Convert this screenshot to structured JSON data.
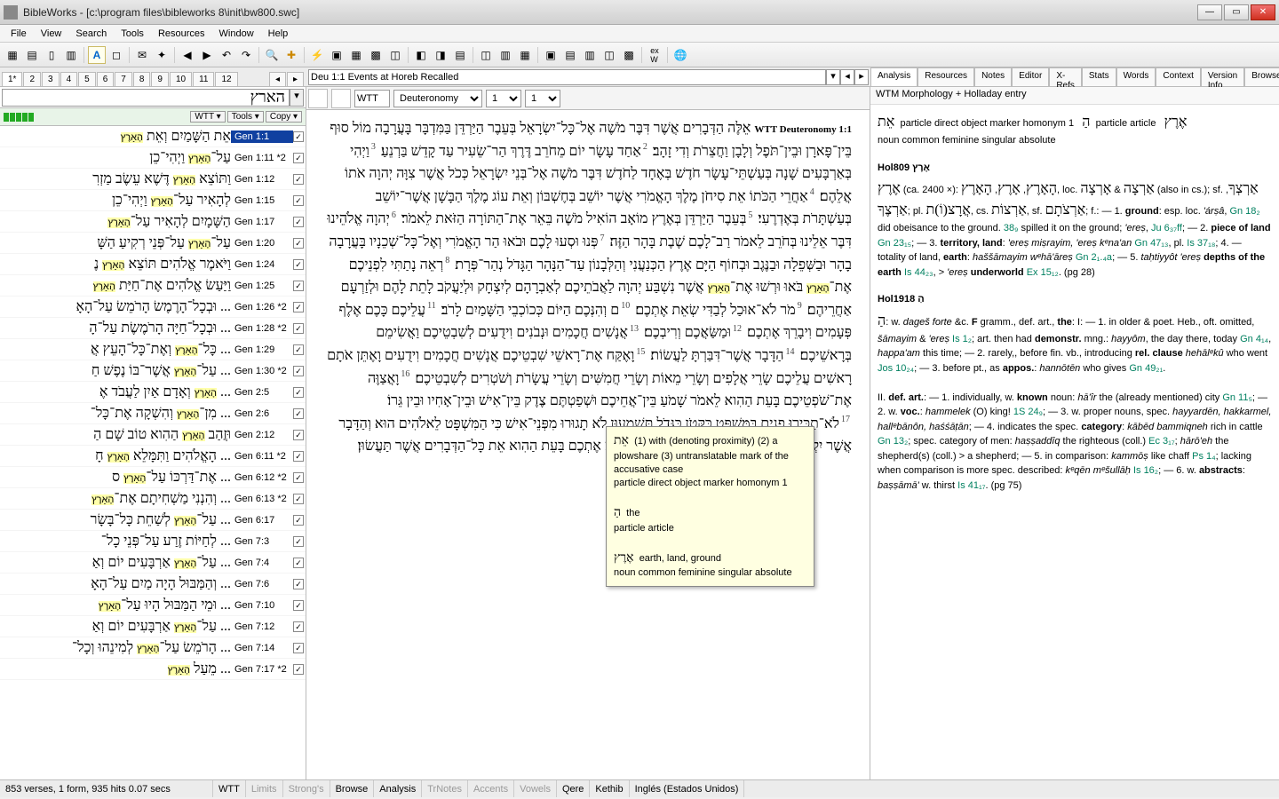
{
  "window": {
    "title": "BibleWorks - [c:\\program files\\bibleworks 8\\init\\bw800.swc]"
  },
  "menus": [
    "File",
    "View",
    "Search",
    "Tools",
    "Resources",
    "Window",
    "Help"
  ],
  "tabs": [
    "1*",
    "2",
    "3",
    "4",
    "5",
    "6",
    "7",
    "8",
    "9",
    "10",
    "11",
    "12"
  ],
  "location": "Deu 1:1 Events at Horeb Recalled",
  "search_term": "הארץ",
  "ctl": {
    "ver": "WTT ▾",
    "tools": "Tools ▾",
    "copy": "Copy ▾"
  },
  "results": [
    {
      "ref": "Gen 1:1",
      "sel": true,
      "heb": "אֵת הַשָּׁמַיִם וְאֵת הָאָרֶץ"
    },
    {
      "ref": "Gen 1:11 *2",
      "heb": "עַל־הָאָרֶץ וַיְהִי־כֵן"
    },
    {
      "ref": "Gen 1:12",
      "heb": "וַתּוֹצֵא הָאָרֶץ דֶּשֶׁא עֵשֶׂב מַזְרִ"
    },
    {
      "ref": "Gen 1:15",
      "heb": "לְהָאִיר עַל־הָאָרֶץ וַיְהִי־כֵן"
    },
    {
      "ref": "Gen 1:17",
      "heb": "הַשָּׁמָיִם לְהָאִיר עַל־הָאָרֶץ"
    },
    {
      "ref": "Gen 1:20",
      "heb": "עַל־הָאָרֶץ עַל־פְּנֵי רְקִיעַ הַשָּׁ"
    },
    {
      "ref": "Gen 1:24",
      "heb": "וַיֹּאמֶר אֱלֹהִים תּוֹצֵא הָאָרֶץ נֶ"
    },
    {
      "ref": "Gen 1:25",
      "heb": "וַיַּעַשׂ אֱלֹהִים אֶת־חַיַּת הָאָרֶץ"
    },
    {
      "ref": "Gen 1:26 *2",
      "heb": "... וּבְכָל־הָרֶמֶשׂ הָרֹמֵשׂ עַל־הָאָ"
    },
    {
      "ref": "Gen 1:28 *2",
      "heb": "... וּבְכָל־חַיָּה הָרֹמֶשֶׂת עַל־הָ"
    },
    {
      "ref": "Gen 1:29",
      "heb": "... כָּל־הָאָרֶץ וְאֶת־כָּל־הָעֵץ אֲ"
    },
    {
      "ref": "Gen 1:30 *2",
      "heb": "... עַל־הָאָרֶץ אֲשֶׁר־בּוֹ נֶפֶשׁ חַ"
    },
    {
      "ref": "Gen 2:5",
      "heb": "... הָאָרֶץ וְאָדָם אַיִן לַעֲבֹד אֶ"
    },
    {
      "ref": "Gen 2:6",
      "heb": "... מִן־הָאָרֶץ וְהִשְׁקָה אֶת־כָּל־"
    },
    {
      "ref": "Gen 2:12",
      "heb": "וּזֲהַב הָאָרֶץ הַהִוא טוֹב שָׁם הַ"
    },
    {
      "ref": "Gen 6:11 *2",
      "heb": "... הָאֱלֹהִים וַתִּמָּלֵא הָאָרֶץ חָ"
    },
    {
      "ref": "Gen 6:12 *2",
      "heb": "... אֶת־דַּרְכּוֹ עַל־הָאָרֶץ ס"
    },
    {
      "ref": "Gen 6:13 *2",
      "heb": "... וְהִנְנִי מַשְׁחִיתָם אֶת־הָאָרֶץ"
    },
    {
      "ref": "Gen 6:17",
      "heb": "... עַל־הָאָרֶץ לְשַׁחֵת כָּל־בָּשָׂר"
    },
    {
      "ref": "Gen 7:3",
      "heb": "... לְחַיּוֹת זֶרַע עַל־פְּנֵי כָל־"
    },
    {
      "ref": "Gen 7:4",
      "heb": "... עַל־הָאָרֶץ אַרְבָּעִים יוֹם וְאַ"
    },
    {
      "ref": "Gen 7:6",
      "heb": "... וְהַמַּבּוּל הָיָה מַיִם עַל־הָאָ"
    },
    {
      "ref": "Gen 7:10",
      "heb": "... וּמֵי הַמַּבּוּל הָיוּ עַל־הָאָרֶץ"
    },
    {
      "ref": "Gen 7:12",
      "heb": "... עַל־הָאָרֶץ אַרְבָּעִים יוֹם וְאַ"
    },
    {
      "ref": "Gen 7:14",
      "heb": "... הָרֹמֵשׂ עַל־הָאָרֶץ לְמִינֵהוּ וְכָל־"
    },
    {
      "ref": "Gen 7:17 *2",
      "heb": "... מֵעַל הָאָרֶץ"
    }
  ],
  "center": {
    "ver": "WTT",
    "book": "Deuteronomy",
    "ch": "1",
    "v": "1",
    "verses": [
      {
        "n": "",
        "lab": "WTT Deuteronomy 1:1",
        "t": "אֵלֶּה הַדְּבָרִים אֲשֶׁר דִּבֶּר מֹשֶׁה אֶל־כָּל־יִשְׂרָאֵל בְּעֵבֶר הַיַּרְדֵּן בַּמִּדְבָּר בָּעֲרָבָה מוֹל סוּף בֵּין־פָּארָן וּבֵין־תֹּפֶל וְלָבָן וַחֲצֵרֹת וְדִי זָהָב׃"
      },
      {
        "n": "2",
        "t": "אַחַד עָשָׂר יוֹם מֵחֹרֵב דֶּרֶךְ הַר־שֵׂעִיר עַד קָדֵשׁ בַּרְנֵעַ׃"
      },
      {
        "n": "3",
        "t": "וַיְהִי בְּאַרְבָּעִים שָׁנָה בְּעַשְׁתֵּי־עָשָׂר חֹדֶשׁ בְּאֶחָד לַחֹדֶשׁ דִּבֶּר מֹשֶׁה אֶל־בְּנֵי יִשְׂרָאֵל כְּכֹל אֲשֶׁר צִוָּה יְהוָה אֹתוֹ אֲלֵהֶם׃"
      },
      {
        "n": "4",
        "t": "אַחֲרֵי הַכֹּתוֹ אֵת סִיחֹן מֶלֶךְ הָאֱמֹרִי אֲשֶׁר יוֹשֵׁב בְּחֶשְׁבּוֹן וְאֵת עוֹג מֶלֶךְ הַבָּשָׁן אֲשֶׁר־יוֹשֵׁב בְּעַשְׁתָּרֹת בְּאֶדְרֶעִי׃"
      },
      {
        "n": "5",
        "t": "בְּעֵבֶר הַיַּרְדֵּן בְּאֶרֶץ מוֹאָב הוֹאִיל מֹשֶׁה בֵּאֵר אֶת־הַתּוֹרָה הַזֹּאת לֵאמֹר׃"
      },
      {
        "n": "6",
        "t": "יְהוָה אֱלֹהֵינוּ דִּבֶּר אֵלֵינוּ בְּחֹרֵב לֵאמֹר רַב־לָכֶם שֶׁבֶת בָּהָר הַזֶּה׃"
      },
      {
        "n": "7",
        "t": "פְּנוּ וּסְעוּ לָכֶם וּבֹאוּ הַר הָאֱמֹרִי וְאֶל־כָּל־שְׁכֵנָיו בָּעֲרָבָה בָהָר וּבַשְּׁפֵלָה וּבַנֶּגֶב וּבְחוֹף הַיָּם אֶרֶץ הַכְּנַעֲנִי וְהַלְּבָנוֹן עַד־הַנָּהָר הַגָּדֹל נְהַר־פְּרָת׃"
      },
      {
        "n": "8",
        "t": "רְאֵה נָתַתִּי לִפְנֵיכֶם אֶת־<hit>הָאָרֶץ</hit> בֹּאוּ וּרְשׁוּ אֶת־<hit>הָאָרֶץ</hit> אֲשֶׁר נִשְׁבַּע יְהוָה לַאֲבֹתֵיכֶם לְאַבְרָהָם לְיִצְחָק וּלְיַעֲקֹב לָתֵת לָהֶם וּלְזַרְעָם אַחֲרֵיהֶם׃"
      },
      {
        "n": "9",
        "t": "מֹר לֹא־אוּכַל לְבַדִּי שְׂאֵת אֶתְכֶם׃"
      },
      {
        "n": "10",
        "t": "ם וְהִנְּכֶם הַיּוֹם כְּכוֹכְבֵי הַשָּׁמַיִם לָרֹב׃"
      },
      {
        "n": "11",
        "t": "עֲלֵיכֶם כָּכֶם אֶלֶף פְּעָמִים וִיבָרֵךְ אֶתְכֶם׃"
      },
      {
        "n": "12",
        "t": "וּמַשַּׂאֲכֶם וְרִיבְכֶם׃"
      },
      {
        "n": "13",
        "t": "אֲנָשִׁים חֲכָמִים וּנְבֹנִים וִידֻעִים לְשִׁבְטֵיכֶם וַאֲשִׂימֵם בְּרָאשֵׁיכֶם׃"
      },
      {
        "n": "14",
        "t": "הַדָּבָר אֲשֶׁר־דִּבַּרְתָּ לַעֲשׂוֹת׃"
      },
      {
        "n": "15",
        "t": "וָאֶקַּח אֶת־רָאשֵׁי שִׁבְטֵיכֶם אֲנָשִׁים חֲכָמִים וִידֻעִים וָאֶתֵּן אֹתָם רָאשִׁים עֲלֵיכֶם שָׂרֵי אֲלָפִים וְשָׂרֵי מֵאוֹת וְשָׂרֵי חֲמִשִּׁים וְשָׂרֵי עֲשָׂרֹת וְשֹׁטְרִים לְשִׁבְטֵיכֶם׃"
      },
      {
        "n": "16",
        "t": "וָאֲצַוֶּה אֶת־שֹׁפְטֵיכֶם בָּעֵת הַהִוא לֵאמֹר שָׁמֹעַ בֵּין־אֲחֵיכֶם וּשְׁפַטְתֶּם צֶדֶק בֵּין־אִישׁ וּבֵין־אָחִיו וּבֵין גֵּרוֹ׃"
      },
      {
        "n": "17",
        "t": "לֹא־תַכִּירוּ פָנִים בַּמִּשְׁפָּט כַּקָּטֹן כַּגָּדֹל תִּשְׁמָעוּן לֹא תָגוּרוּ מִפְּנֵי־אִישׁ כִּי הַמִּשְׁפָּט לֵאלֹהִים הוּא וְהַדָּבָר אֲשֶׁר יִקְשֶׁה מִכֶּם תַּקְרִבוּן אֵלַי וּשְׁמַעְתִּיו׃"
      },
      {
        "n": "18",
        "t": "וָאֲצַוֶּה אֶתְכֶם בָּעֵת הַהִוא אֵת כָּל־הַדְּבָרִים אֲשֶׁר תַּעֲשׂוּן׃"
      }
    ]
  },
  "analysis": {
    "tabs": [
      "Analysis",
      "Resources",
      "Notes",
      "Editor",
      "X-Refs",
      "Stats",
      "Words",
      "Context",
      "Version Info",
      "Browse"
    ],
    "head": "WTM Morphology + Holladay entry",
    "morph": "particle direct object marker homonym 1 &nbsp;&nbsp;<span class='heb'>הַ</span>&nbsp; particle article &nbsp;&nbsp;<span class='heb'>אֶרֶץ</span><br>noun common feminine singular absolute",
    "morph_w": "אֵת",
    "e1": {
      "hd": "Hol809 אֶרֶץ",
      "body": "<span class='heb'>אֶרֶץ</span> (ca. 2400 ×): <span class='heb'>הָאָרֶץ</span>, <span class='heb'>אָרֶץ</span>, <span class='heb'>הָאָרֶץ</span>, loc. <span class='heb'>אַרְצָה</span> &amp; <span class='heb'>אָרְצָה</span> (also in cs.); sf. <span class='heb'>אַרְצְךָ</span>, <span class='heb'>אַרְצֶךָ</span>; pl. <span class='heb'>אֲרָצ(וֹ)ת</span>, cs. <span class='heb'>אַרְצוֹת</span>, sf. <span class='heb'>אַרְצֹתָם</span>; f.: — 1. <b>ground</b>: esp. loc. <i>'árṣâ</i>, <span class='link'>Gn 18₂</span> did obeisance to the ground. <span class='link'>38₉</span> spilled it on the ground; <i>'ereṣ</i>, <span class='link'>Ju 6₃₇ff</span>; — 2. <b>piece of land</b> <span class='link'>Gn 23₁₅</span>; — 3. <b>territory, land</b>: <i>'ereṣ miṣrayim, 'ereṣ kᵉna'an</i> <span class='link'>Gn 47₁₃</span>, pl. <span class='link'>Is 37₁₈</span>; 4. — totality of land, <b>earth</b>: <i>haššāmayim wᵉhā'āreṣ</i> <span class='link'>Gn 2₁.₄a</span>; — 5. <i>taḥtiyyôt 'ereṣ</i> <b>depths of the earth</b> <span class='link'>Is 44₂₃</span>, > <i>'ereṣ</i> <b>underworld</b> <span class='link'>Ex 15₁₂</span>. (pg 28)"
    },
    "e2": {
      "hd": "Hol1918 הַ",
      "body": "<span class='heb'>הַ</span>: w. <i>dageš forte</i> &amp;c. <b>F</b> gramm., def. art., <b>the</b>: I: — 1. in older &amp; poet. Heb., oft. omitted, <i>šāmayim</i> &amp; <i>'ereṣ</i> <span class='link'>Is 1₂</span>; art. then had <b>demonstr.</b> mng.: <i>hayyôm</i>, the day there, today <span class='link'>Gn 4₁₄</span>, <i>happa'am</i> this time; — 2. rarely,, before fin. vb., introducing <b>rel. clause</b> <i>hehālᵉkû</i> who went <span class='link'>Jos 10₂₄</span>; — 3. before pt., as <b>appos.</b>: <i>hannōtēn</i> who gives <span class='link'>Gn 49₂₁</span>.<br><br>II. <b>def. art.</b>: — 1. individually, w. <b>known</b> noun: <i>hā'îr</i> the (already mentioned) city <span class='link'>Gn 11₅</span>; — 2. w. <b>voc.</b>: <i>hammelek</i> (O) king! <span class='link'>1S 24₉</span>; — 3. w. proper nouns, spec. <i>hayyardēn, hakkarmel, hallᵉbānôn, haśśāṭān</i>; — 4. indicates the spec. <b>category</b>: <i>kābēd bammiqneh</i> rich in cattle <span class='link'>Gn 13₂</span>; spec. category of men: <i>haṣṣaddîq</i> the righteous (coll.) <span class='link'>Ec 3₁₇</span>; <i>hārō'eh</i> the shepherd(s) (coll.) > a shepherd; — 5. in comparison: <i>kammōṣ</i> like chaff <span class='link'>Ps 1₄</span>; lacking when comparison is more spec. described: <i>kᵉqēn mᵉšullāḥ</i> <span class='link'>Is 16₂</span>; — 6. w. <b>abstracts</b>: <i>baṣṣāmā'</i> w. thirst <span class='link'>Is 41₁₇</span>. (pg 75)"
    }
  },
  "tooltip": {
    "l1": "(1) with (denoting proximity) (2) a plowshare (3) untranslatable mark of the accusative case",
    "l1w": "אֵת",
    "l1m": "particle direct object marker homonym 1",
    "l2w": "הַ",
    "l2t": "the",
    "l2m": "particle article",
    "l3w": "אֶרֶץ",
    "l3t": "earth, land, ground",
    "l3m": "noun common feminine singular absolute"
  },
  "status": {
    "left": "853 verses, 1 form, 935 hits 0.07 secs",
    "cells": [
      "WTT",
      "Limits",
      "Strong's",
      "Browse",
      "Analysis",
      "TrNotes",
      "Accents",
      "Vowels",
      "Qere",
      "Kethib",
      "Inglés (Estados Unidos)"
    ]
  }
}
